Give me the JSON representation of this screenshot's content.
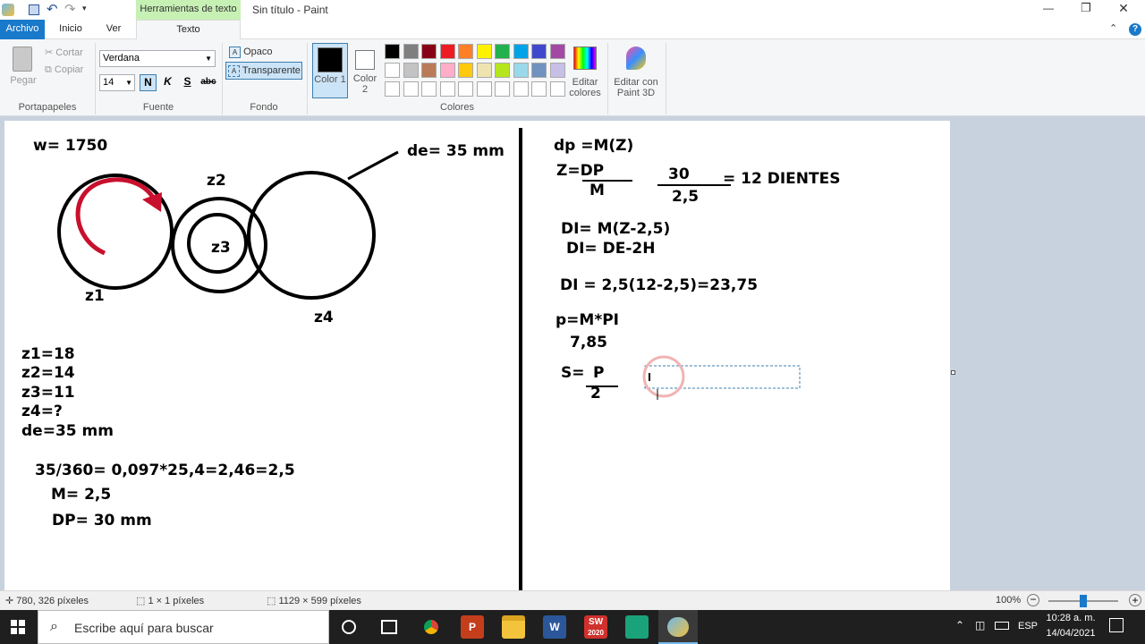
{
  "window": {
    "title": "Sin título - Paint",
    "context_tab": "Herramientas de texto",
    "controls": {
      "minimize": "—",
      "restore": "❐",
      "close": "✕"
    }
  },
  "tabs": {
    "archivo": "Archivo",
    "inicio": "Inicio",
    "ver": "Ver",
    "texto": "Texto"
  },
  "ribbon": {
    "clipboard": {
      "pegar": "Pegar",
      "cortar": "Cortar",
      "copiar": "Copiar",
      "group": "Portapapeles"
    },
    "font": {
      "family": "Verdana",
      "size": "14",
      "bold": "N",
      "italic": "K",
      "underline": "S",
      "strike": "abc",
      "group": "Fuente"
    },
    "background": {
      "opaco": "Opaco",
      "transparente": "Transparente",
      "group": "Fondo"
    },
    "colors": {
      "color1_label": "Color 1",
      "color2_label": "Color 2",
      "group": "Colores",
      "color1": "#000000",
      "color2": "#ffffff",
      "row1": [
        "#000000",
        "#7f7f7f",
        "#880015",
        "#ed1c24",
        "#ff7f27",
        "#fff200",
        "#22b14c",
        "#00a2e8",
        "#3f48cc",
        "#a349a4"
      ],
      "row2": [
        "#ffffff",
        "#c3c3c3",
        "#b97a57",
        "#ffaec9",
        "#ffc90e",
        "#efe4b0",
        "#b5e61d",
        "#99d9ea",
        "#7092be",
        "#c8bfe7"
      ],
      "edit_colors": "Editar colores"
    },
    "paint3d": "Editar con Paint 3D"
  },
  "canvas": {
    "left_notes": {
      "w": "w= 1750",
      "de_label": "de= 35 mm",
      "gear_z1": "z1",
      "gear_z2": "z2",
      "gear_z3": "z3",
      "gear_z4": "z4",
      "list": [
        "z1=18",
        "z2=14",
        "z3=11",
        "z4=?",
        "de=35 mm"
      ],
      "calc1": "35/360= 0,097*25,4=2,46=2,5",
      "calc2": "M= 2,5",
      "calc3": "DP= 30 mm"
    },
    "right_notes": {
      "l1": "dp =M(Z)",
      "l2a": "Z=DP",
      "l2b": "M",
      "l2c": "30",
      "l2d": "2,5",
      "l2e": "= 12 DIENTES",
      "l3": "DI= M(Z-2,5)",
      "l4": "DI= DE-2H",
      "l5": "DI = 2,5(12-2,5)=23,75",
      "l6": "p=M*PI",
      "l7": "7,85",
      "l8a": "S=",
      "l8b": "P",
      "l8c": "2"
    }
  },
  "status": {
    "cursor": "780, 326 píxeles",
    "selection": "1 × 1 píxeles",
    "size": "1129 × 599 píxeles",
    "zoom": "100%",
    "zoom_level": 0.5
  },
  "taskbar": {
    "search_placeholder": "Escribe aquí para buscar",
    "lang": "ESP",
    "time": "10:28 a. m.",
    "date": "14/04/2021",
    "sw_badge": "2020"
  }
}
